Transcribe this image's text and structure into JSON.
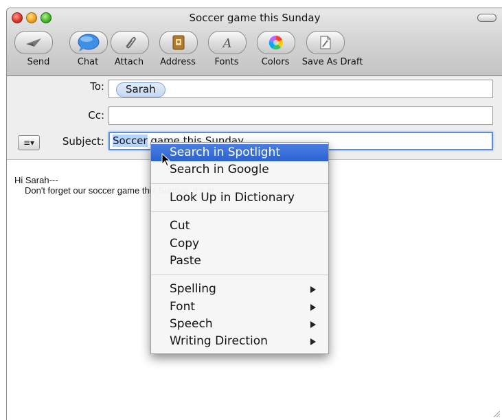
{
  "window": {
    "title": "Soccer game this Sunday"
  },
  "toolbar": {
    "send": "Send",
    "chat": "Chat",
    "attach": "Attach",
    "address": "Address",
    "fonts": "Fonts",
    "colors": "Colors",
    "save_as_draft": "Save As Draft"
  },
  "headers": {
    "to_label": "To:",
    "to_recipient": "Sarah",
    "cc_label": "Cc:",
    "cc_value": "",
    "subject_label": "Subject:",
    "subject_selected": "Soccer",
    "subject_rest": " game this Sunday"
  },
  "message": {
    "line1": "Hi Sarah---",
    "line2": "Don't forget our soccer game this Sunday.  It's at"
  },
  "context_menu": {
    "items": [
      {
        "label": "Search in Spotlight",
        "highlighted": true
      },
      {
        "label": "Search in Google"
      },
      {
        "label": "Look Up in Dictionary"
      },
      {
        "label": "Cut"
      },
      {
        "label": "Copy"
      },
      {
        "label": "Paste"
      },
      {
        "label": "Spelling",
        "submenu": true
      },
      {
        "label": "Font",
        "submenu": true
      },
      {
        "label": "Speech",
        "submenu": true
      },
      {
        "label": "Writing Direction",
        "submenu": true
      }
    ]
  },
  "colors": {
    "accent": "#2b62d2",
    "selection": "#b5d5ff"
  }
}
